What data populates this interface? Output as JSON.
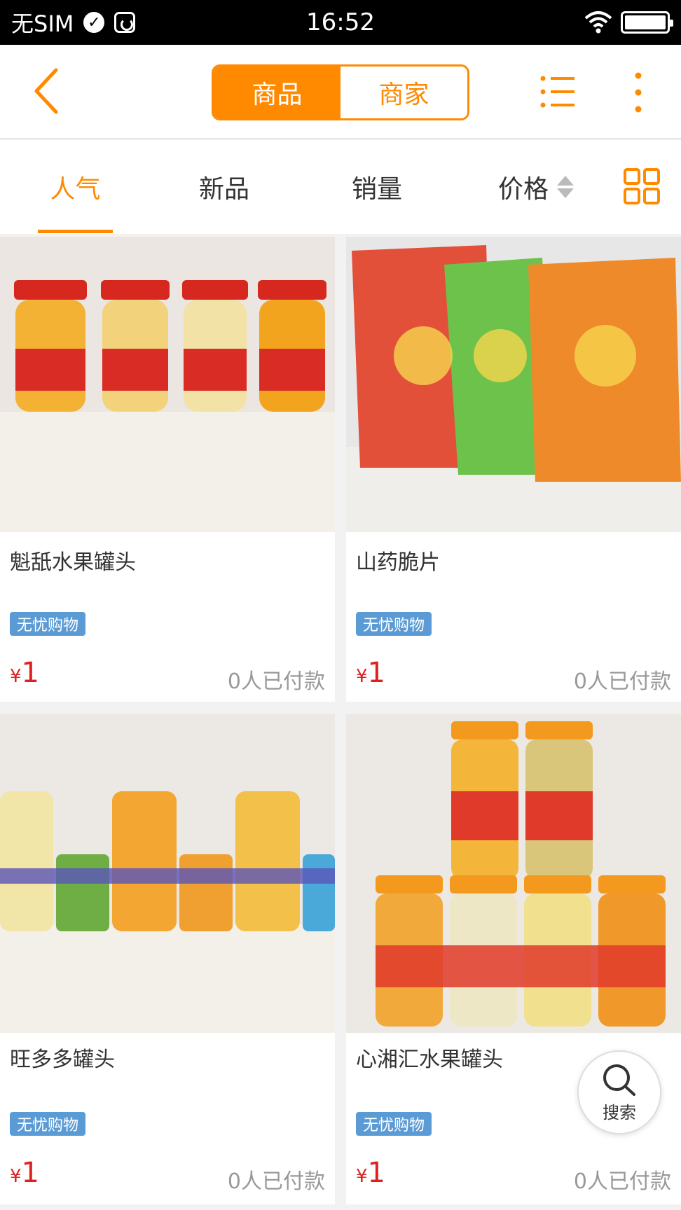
{
  "status_bar": {
    "carrier": "无SIM",
    "time": "16:52"
  },
  "header": {
    "tab_products": "商品",
    "tab_shops": "商家"
  },
  "sort_bar": {
    "popular": "人气",
    "new": "新品",
    "sales": "销量",
    "price": "价格"
  },
  "products": [
    {
      "name": "魁舐水果罐头",
      "badge": "无忧购物",
      "currency": "¥",
      "price": "1",
      "sold": "0人已付款"
    },
    {
      "name": "山药脆片",
      "badge": "无忧购物",
      "currency": "¥",
      "price": "1",
      "sold": "0人已付款"
    },
    {
      "name": "旺多多罐头",
      "badge": "无忧购物",
      "currency": "¥",
      "price": "1",
      "sold": "0人已付款"
    },
    {
      "name": "心湘汇水果罐头",
      "badge": "无忧购物",
      "currency": "¥",
      "price": "1",
      "sold": "0人已付款"
    }
  ],
  "search_fab": {
    "label": "搜索"
  },
  "colors": {
    "accent": "#ff8a00",
    "price": "#e02020",
    "badge": "#5b9bd5"
  }
}
